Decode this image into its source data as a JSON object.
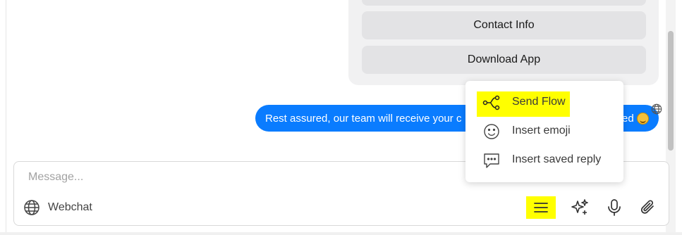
{
  "conversation": {
    "quick_replies": [
      {
        "label": ""
      },
      {
        "label": "Contact Info"
      },
      {
        "label": "Download App"
      }
    ],
    "outgoing_message": {
      "text_start": "Rest assured, our team will receive your c",
      "text_end": "ed",
      "emoji": "smiling-face-emoji"
    }
  },
  "popup_menu": {
    "items": [
      {
        "label": "Send Flow",
        "icon": "flow-icon",
        "highlighted": true
      },
      {
        "label": "Insert emoji",
        "icon": "smiley-icon"
      },
      {
        "label": "Insert saved reply",
        "icon": "saved-reply-icon"
      }
    ]
  },
  "composer": {
    "placeholder": "Message...",
    "value": "",
    "channel_label": "Webchat",
    "channel_icon": "globe-icon",
    "tools": [
      {
        "name": "menu",
        "icon": "hamburger-icon",
        "highlighted": true
      },
      {
        "name": "ai",
        "icon": "sparkles-icon"
      },
      {
        "name": "voice",
        "icon": "microphone-icon"
      },
      {
        "name": "attach",
        "icon": "paperclip-icon"
      }
    ]
  },
  "colors": {
    "bubble": "#0a7cff",
    "highlight": "#ffff00",
    "card": "#f1f1f2",
    "quick_reply": "#e3e3e5"
  }
}
